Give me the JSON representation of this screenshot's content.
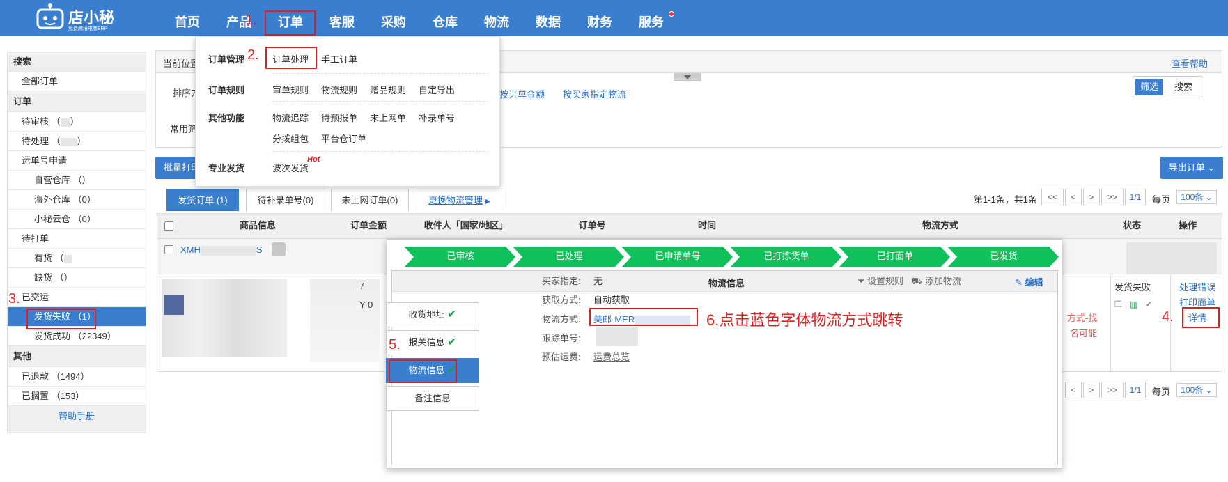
{
  "header": {
    "logo_text": "店小秘",
    "logo_sub": "免费跨境电商ERP",
    "nav": [
      "首页",
      "产品",
      "订单",
      "客服",
      "采购",
      "仓库",
      "物流",
      "数据",
      "财务",
      "服务"
    ]
  },
  "annotations": {
    "a1": "1.",
    "a2": "2.",
    "a3": "3.",
    "a4": "4.",
    "a5": "5.",
    "a6": "6.点击蓝色字体物流方式跳转"
  },
  "dropdown": {
    "row1_head": "订单管理",
    "row1_items": [
      "订单处理",
      "手工订单"
    ],
    "row2_head": "订单规则",
    "row2_items": [
      "审单规则",
      "物流规则",
      "赠品规则",
      "自定导出"
    ],
    "row3_head": "其他功能",
    "row3_items": [
      "物流追踪",
      "待预报单",
      "未上网单",
      "补录单号",
      "分拨组包",
      "平台仓订单"
    ],
    "row4_head": "专业发货",
    "row4_items": [
      "波次发货"
    ],
    "hot": "Hot"
  },
  "sidebar": {
    "search_head": "搜索",
    "all_orders": "全部订单",
    "order_head": "订单",
    "pending_review": "待审核 （",
    "pending_review_end": "）",
    "pending_process": "待处理 （",
    "pending_process_end": "）",
    "waybill_apply": "运单号申请",
    "self_warehouse": "自营仓库 （",
    "self_warehouse_end": "）",
    "overseas_warehouse": "海外仓库 （0）",
    "cloud_warehouse": "小秘云仓 （0）",
    "to_print": "待打单",
    "in_stock": "有货 （",
    "in_stock_end": "）",
    "out_stock": "缺货 （",
    "out_stock_end": "）",
    "shipped": "已交运",
    "ship_failed": "发货失败 （",
    "ship_failed_num": "1",
    "ship_failed_end": "）",
    "ship_success": "发货成功 （22349）",
    "other_head": "其他",
    "refunded": "已退款 （1494）",
    "shelved": "已搁置 （153）",
    "help": "帮助手册"
  },
  "main": {
    "breadcrumb": "当前位置",
    "view_help": "查看帮助",
    "sort_label": "排序方",
    "sort_by_amount": "按订单金额",
    "sort_by_buyer_logistics": "按买家指定物流",
    "filter_btn": "筛选",
    "search_btn": "搜索",
    "common_filter": "常用筛",
    "batch_print": "批量打印",
    "export_btn": "导出订单",
    "tabs": [
      "发货订单 (1)",
      "待补录单号(0)",
      "未上网订单(0)"
    ],
    "change_logistics": "更换物流管理",
    "pagination_info": "第1-1条，共1条",
    "pg_first": "<<",
    "pg_prev": "<",
    "pg_next": ">",
    "pg_last": ">>",
    "pg_page": "1/1",
    "per_page_label": "每页",
    "per_page_value": "100条",
    "columns": [
      "商品信息",
      "订单金额",
      "收件人「国家/地区」",
      "订单号",
      "时间",
      "物流方式",
      "状态",
      "操作"
    ],
    "order_no_prefix": "XMH",
    "order_no_suffix": "S",
    "amount_partial": "7",
    "amount_partial2": "Y 0",
    "status_failed": "发货失败",
    "action_handle_error": "处理错误",
    "action_print": "打印面单",
    "action_detail": "详情",
    "side_red1": "方式-找",
    "side_red2": "名可能"
  },
  "popup": {
    "steps": [
      "已审核",
      "已处理",
      "已申请单号",
      "已打拣货单",
      "已打面单",
      "已发货"
    ],
    "section_title": "物流信息",
    "edit": "编辑",
    "left_tabs": [
      "收货地址",
      "报关信息",
      "物流信息",
      "备注信息"
    ],
    "buyer_specified_label": "买家指定:",
    "buyer_specified_value": "无",
    "get_method_label": "获取方式:",
    "get_method_value": "自动获取",
    "logistics_label": "物流方式:",
    "logistics_value": "美邮-MER",
    "tracking_label": "跟踪单号:",
    "freight_label": "预估运费:",
    "freight_value": "运费总览",
    "set_rule": "设置规则",
    "add_logistics": "添加物流"
  },
  "colors": {
    "header": "#3a7fcf",
    "step": "#0fc15a",
    "annotation": "#e02020",
    "link": "#2a6fc2"
  }
}
